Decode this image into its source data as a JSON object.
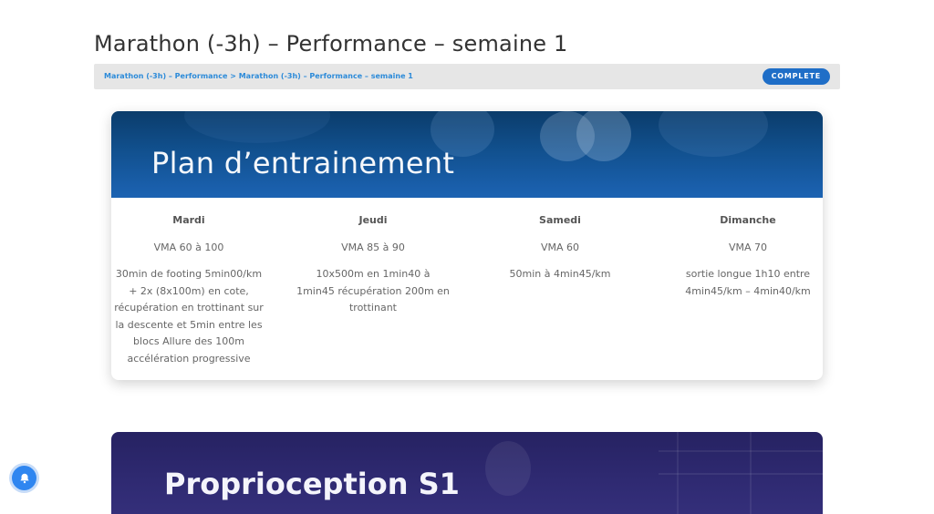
{
  "page": {
    "title": "Marathon (-3h) – Performance – semaine 1"
  },
  "breadcrumb": {
    "parent": "Marathon (-3h) – Performance",
    "separator": ">",
    "current": "Marathon (-3h) – Performance – semaine 1",
    "status": "COMPLETE"
  },
  "colors": {
    "accent": "#1f6ec7",
    "breadcrumb_link": "#2d8bd9",
    "card1_header": "#11508e",
    "card2_header": "#2f2a72",
    "notification": "#2f86f0"
  },
  "plan": {
    "title": "Plan d’entrainement",
    "days": [
      {
        "day": "Mardi",
        "vma": "VMA 60 à 100",
        "description": "30min de footing 5min00/km + 2x (8x100m) en cote, récupération en trottinant sur la descente et 5min entre les blocs Allure des 100m accélération progressive"
      },
      {
        "day": "Jeudi",
        "vma": "VMA 85 à 90",
        "description": "10x500m en 1min40 à 1min45 récupération 200m en trottinant"
      },
      {
        "day": "Samedi",
        "vma": "VMA 60",
        "description": "50min à 4min45/km"
      },
      {
        "day": "Dimanche",
        "vma": "VMA 70",
        "description": "sortie longue 1h10 entre 4min45/km – 4min40/km"
      }
    ]
  },
  "proprioception": {
    "title": "Proprioception S1"
  },
  "icons": {
    "notification": "bell-icon"
  }
}
